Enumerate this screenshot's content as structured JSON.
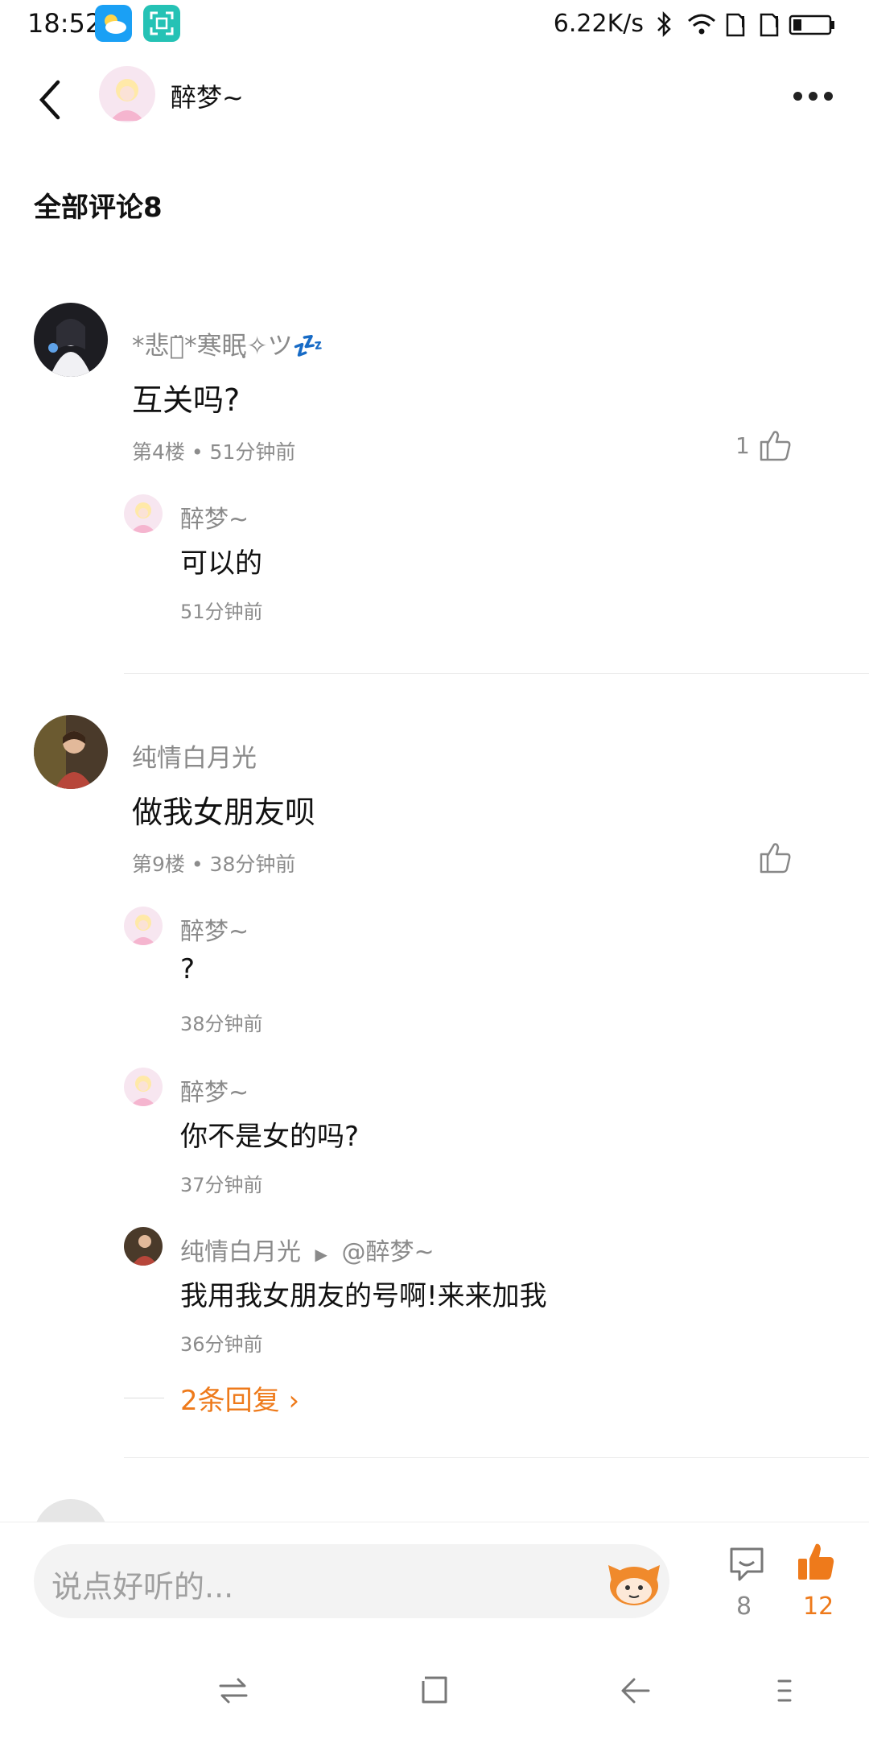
{
  "status_bar": {
    "time": "18:52",
    "network_speed": "6.22K/s",
    "icons": [
      "weather-app-icon",
      "scanner-app-icon",
      "bluetooth-icon",
      "wifi-icon",
      "sim1-icon",
      "sim2-icon",
      "battery-icon"
    ]
  },
  "header": {
    "title": "醉梦~",
    "back_icon": "back-arrow-icon",
    "more_icon": "more-dots-icon"
  },
  "section_title": "全部评论8",
  "comments": [
    {
      "username": "*悲伤̈*寒眠ฺ✧ツ💤",
      "text": "互关吗?",
      "meta": "第4楼 • 51分钟前",
      "like_count": "1",
      "replies": [
        {
          "username": "醉梦~",
          "text": "可以的",
          "time": "51分钟前"
        }
      ]
    },
    {
      "username": "纯情白月光",
      "text": "做我女朋友呗",
      "meta": "第9楼 • 38分钟前",
      "like_count": "",
      "replies": [
        {
          "username": "醉梦~",
          "text": "?",
          "time": "38分钟前"
        },
        {
          "username": "醉梦~",
          "text": "你不是女的吗?",
          "time": "37分钟前"
        },
        {
          "username": "纯情白月光",
          "reply_to": "@醉梦~",
          "text": "我用我女朋友的号啊!来来加我",
          "time": "36分钟前"
        }
      ],
      "more_replies": "2条回复 ›"
    }
  ],
  "bottom_bar": {
    "input_placeholder": "说点好听的...",
    "comment_count": "8",
    "like_count": "12",
    "accent_color": "#ee7a1b"
  },
  "nav_bar": {
    "icons": [
      "switch-icon",
      "home-square-icon",
      "back-icon",
      "menu-icon"
    ]
  }
}
